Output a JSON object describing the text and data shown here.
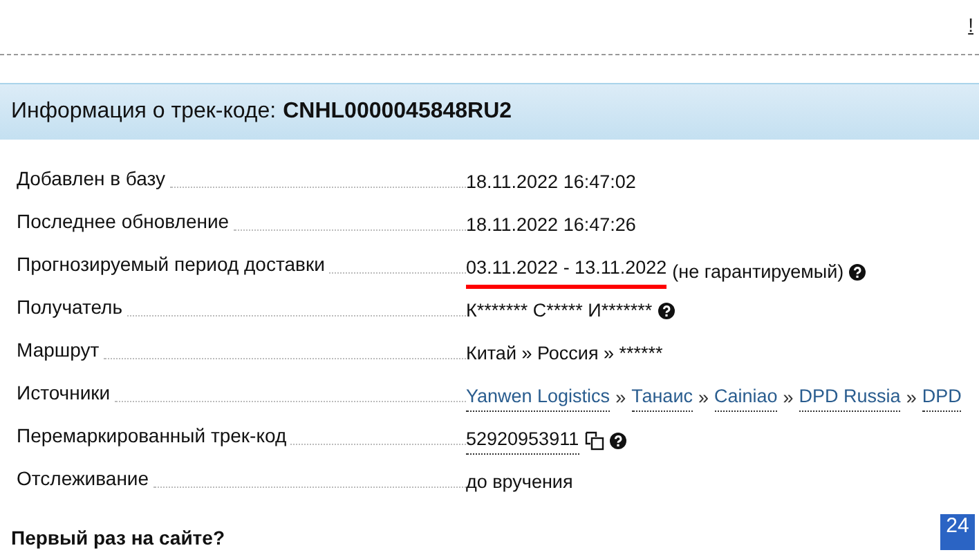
{
  "top_link": "!",
  "header": {
    "label": "Информация о трек-коде:",
    "code": "CNHL0000045848RU2"
  },
  "rows": [
    {
      "label": "Добавлен в базу",
      "kind": "text",
      "value": "18.11.2022 16:47:02"
    },
    {
      "label": "Последнее обновление",
      "kind": "text",
      "value": "18.11.2022 16:47:26"
    },
    {
      "label": "Прогнозируемый период доставки",
      "kind": "period",
      "value": "03.11.2022 - 13.11.2022",
      "highlighted": true,
      "note": "(не гарантируемый)",
      "help": true
    },
    {
      "label": "Получатель",
      "kind": "text",
      "value": "К******* С***** И*******",
      "help": true
    },
    {
      "label": "Маршрут",
      "kind": "text",
      "value": "Китай » Россия » ******"
    },
    {
      "label": "Источники",
      "kind": "links",
      "links": [
        "Yanwen Logistics",
        "Танаис",
        "Cainiao",
        "DPD Russia",
        "DPD"
      ],
      "separator": "»"
    },
    {
      "label": "Перемаркированный трек-код",
      "kind": "code",
      "value": "52920953911",
      "copy": true,
      "help": true
    },
    {
      "label": "Отслеживание",
      "kind": "text",
      "value": "до вручения"
    }
  ],
  "footer_heading": "Первый раз на сайте?",
  "badge": "24"
}
